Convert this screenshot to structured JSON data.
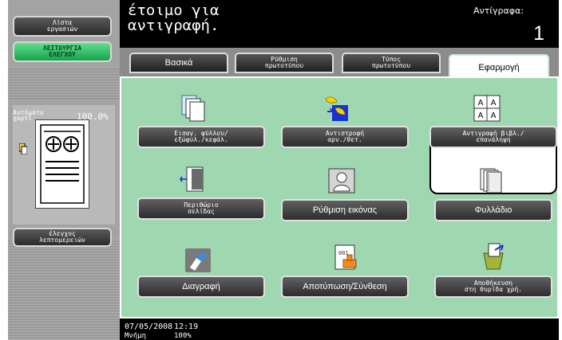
{
  "left": {
    "job_list": "Λίστα\nεργασιών",
    "check_function": "ΛΕΙΤΟΥΡΓΙΑ\nΕΛΕΓΧΟΥ",
    "paper_label": "Αυτόματο\nχαρτί",
    "zoom": "100.0%",
    "check_details": "έλεγχος\nλεπτομερειών"
  },
  "status": {
    "message": "έτοιμο για\nαντιγραφή.",
    "copies_label": "Αντίγραφα:",
    "copies_value": "1"
  },
  "tabs": [
    {
      "label": "Βασικά"
    },
    {
      "label": "Ρύθμιση\nπρωτοτύπου"
    },
    {
      "label": "Τύπος\nπρωτοτύπου"
    },
    {
      "label": "Εφαρμογή"
    }
  ],
  "functions": [
    {
      "label": "Εισαγ. φύλλου/\nεξώφυλ./κεφάλ.",
      "icon": "insert-sheet-icon"
    },
    {
      "label": "Αντιστροφή\nαρν./θετ.",
      "icon": "neg-pos-reverse-icon"
    },
    {
      "label": "Αντιγραφή βιβλ./\nεπανάληψη",
      "icon": "book-copy-repeat-icon"
    },
    {
      "label": "Περιθώριο\nσελίδας",
      "icon": "page-margin-icon"
    },
    {
      "label": "Ρύθμιση εικόνας",
      "icon": "image-adjust-icon"
    },
    {
      "label": "Φυλλάδιο",
      "icon": "booklet-icon"
    },
    {
      "label": "Διαγραφή",
      "icon": "erase-icon"
    },
    {
      "label": "Αποτύπωση/Σύνθεση",
      "icon": "stamp-composition-icon"
    },
    {
      "label": "Αποθήκευση\nστη θυρίδα χρή.",
      "icon": "save-user-box-icon"
    }
  ],
  "footer": {
    "date": "07/05/2008",
    "time": "12:19",
    "memory_label": "Μνήμη",
    "memory_value": "100%"
  }
}
